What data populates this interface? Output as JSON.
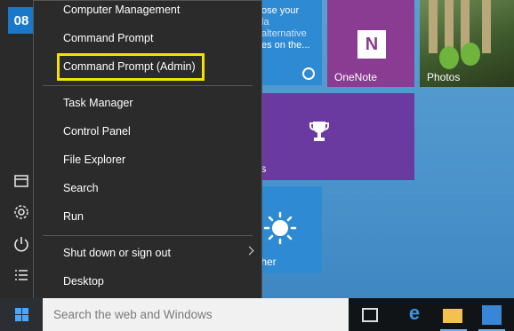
{
  "start_menu": {
    "user_initials": "08",
    "tiles": {
      "news": {
        "text_lines": [
          "ose your",
          "la",
          "alternative",
          "es on the..."
        ]
      },
      "onenote": {
        "label": "OneNote",
        "logo_glyph": "N"
      },
      "photos": {
        "label": "Photos"
      },
      "xbox": {
        "label_partial": "ts"
      },
      "weather": {
        "label_partial": "ther"
      }
    },
    "rail_icons": [
      "file-explorer-icon",
      "settings-icon",
      "power-icon",
      "all-apps-icon"
    ]
  },
  "context_menu": {
    "items": [
      {
        "label": "Computer Management"
      },
      {
        "label": "Command Prompt"
      },
      {
        "label": "Command Prompt (Admin)",
        "highlighted": true
      },
      {
        "label": "Task Manager"
      },
      {
        "label": "Control Panel"
      },
      {
        "label": "File Explorer"
      },
      {
        "label": "Search"
      },
      {
        "label": "Run"
      },
      {
        "label": "Shut down or sign out",
        "has_submenu": true
      },
      {
        "label": "Desktop"
      }
    ],
    "highlight_color": "#f3e400"
  },
  "taskbar": {
    "search_placeholder": "Search the web and Windows",
    "icons": [
      "task-view-icon",
      "edge-icon",
      "file-explorer-icon",
      "store-icon"
    ]
  },
  "colors": {
    "accent": "#4aa6ff",
    "menu_bg": "#2b2b2b",
    "onenote": "#8a3b92",
    "xbox": "#6b3aa0",
    "tile_blue": "#2d8ad3"
  }
}
